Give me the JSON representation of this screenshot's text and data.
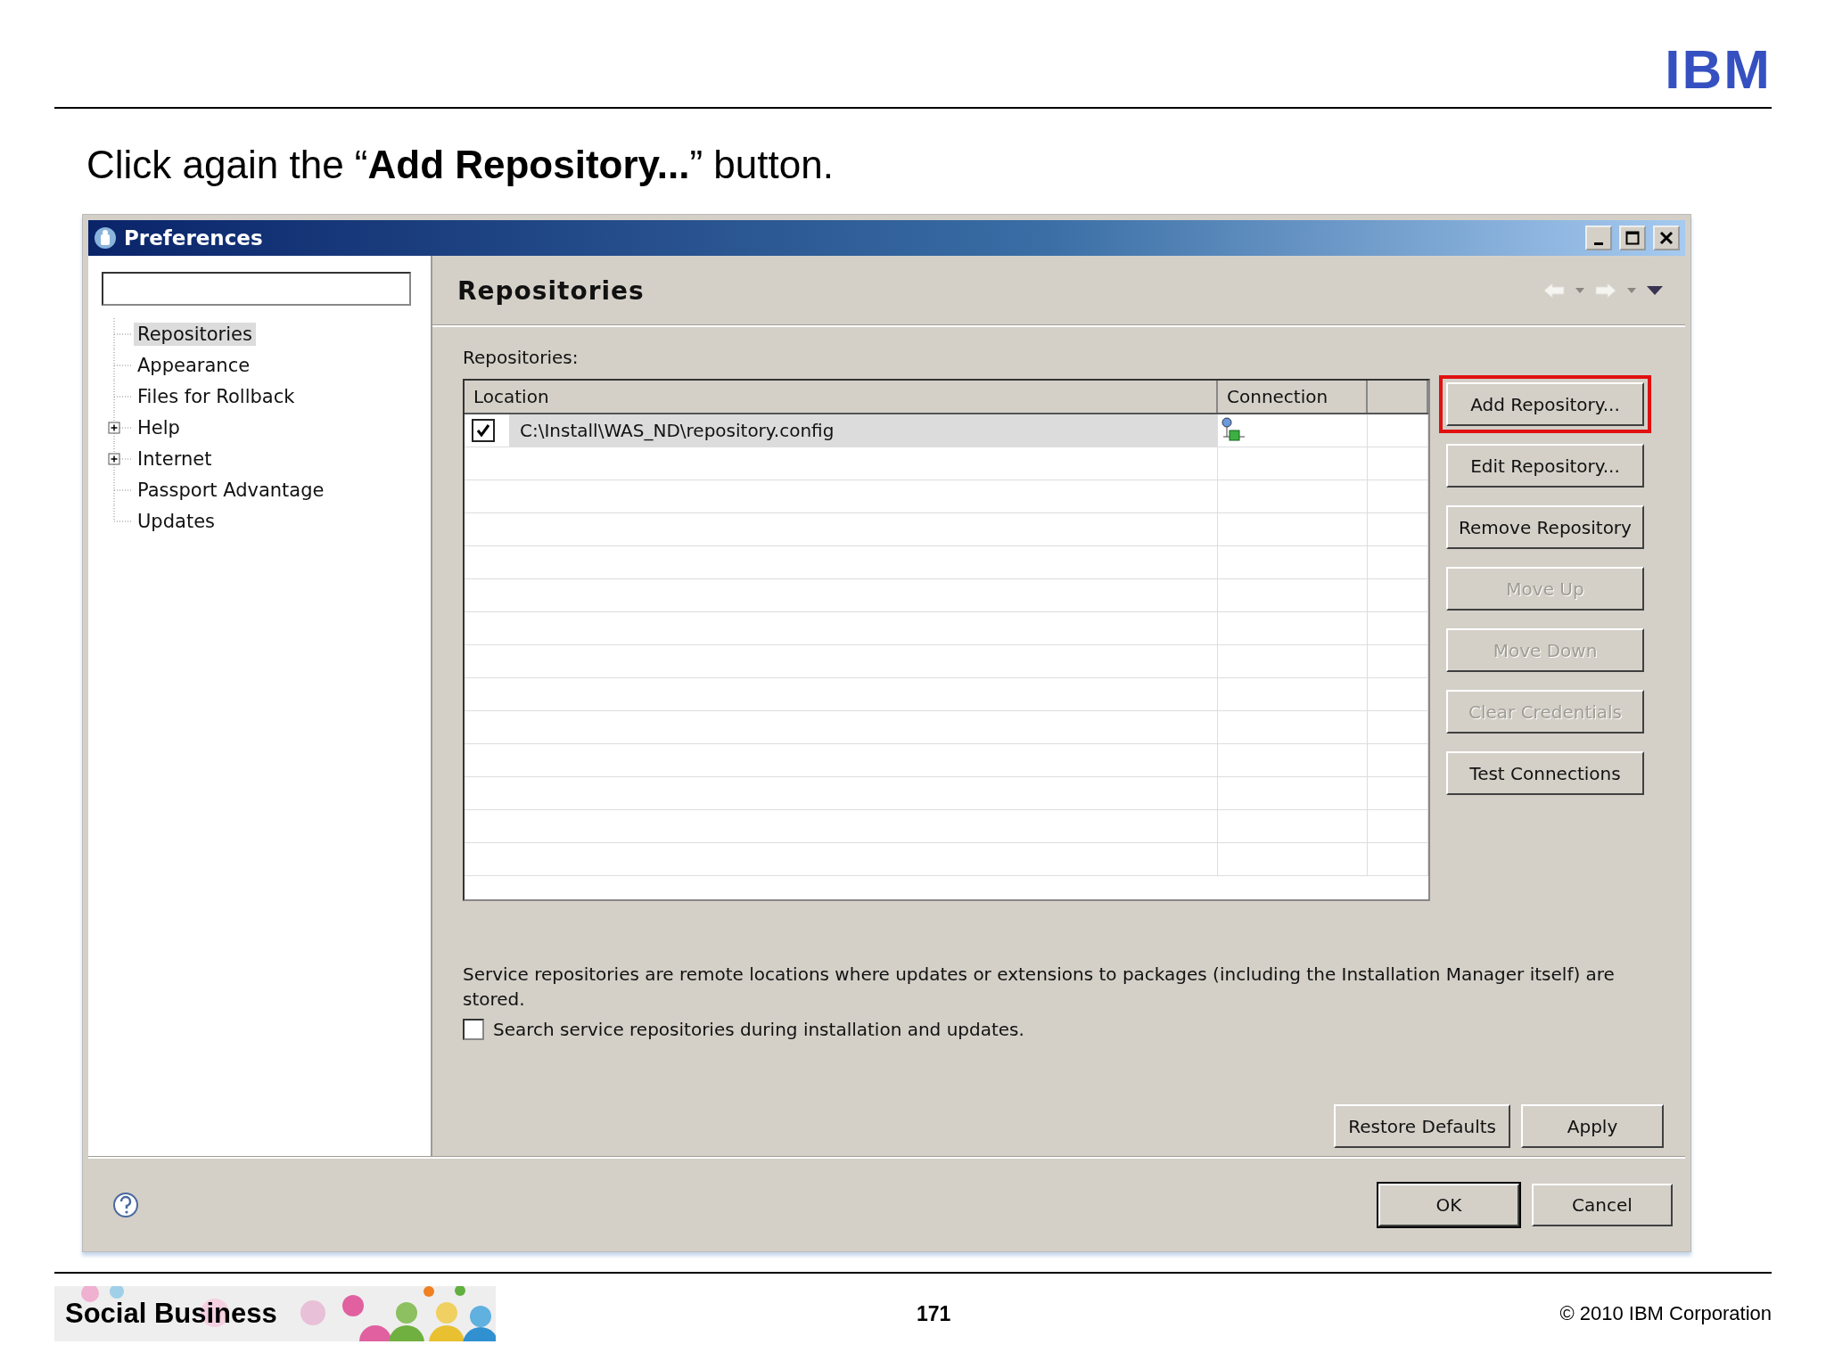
{
  "slide": {
    "logo": "IBM",
    "heading": "Click again the “**Add Repository...**” button.",
    "footer": {
      "banner": "Social Business",
      "page": "171",
      "copyright": "© 2010 IBM Corporation"
    }
  },
  "window": {
    "title": "Preferences"
  },
  "sidebar": {
    "items": [
      {
        "label": "Repositories",
        "selected": true,
        "kind": "leaf"
      },
      {
        "label": "Appearance",
        "selected": false,
        "kind": "leaf"
      },
      {
        "label": "Files for Rollback",
        "selected": false,
        "kind": "leaf"
      },
      {
        "label": "Help",
        "selected": false,
        "kind": "folder"
      },
      {
        "label": "Internet",
        "selected": false,
        "kind": "folder"
      },
      {
        "label": "Passport Advantage",
        "selected": false,
        "kind": "leaf"
      },
      {
        "label": "Updates",
        "selected": false,
        "kind": "leaf"
      }
    ]
  },
  "page": {
    "title": "Repositories",
    "table_label": "Repositories:",
    "table": {
      "columns": [
        "Location",
        "Connection"
      ],
      "rows": [
        {
          "checked": true,
          "selected": true,
          "location": "C:\\Install\\WAS_ND\\repository.config"
        }
      ]
    },
    "side_buttons": [
      {
        "label": "Add Repository...",
        "disabled": false,
        "highlighted": true
      },
      {
        "label": "Edit Repository...",
        "disabled": false,
        "highlighted": false
      },
      {
        "label": "Remove Repository",
        "disabled": false,
        "highlighted": false
      },
      {
        "label": "Move Up",
        "disabled": true,
        "highlighted": false
      },
      {
        "label": "Move Down",
        "disabled": true,
        "highlighted": false
      },
      {
        "label": "Clear Credentials",
        "disabled": true,
        "highlighted": false
      },
      {
        "label": "Test Connections",
        "disabled": false,
        "highlighted": false
      }
    ],
    "description": "Service repositories are remote locations where updates or extensions to packages (including the Installation Manager itself) are stored.",
    "search_option": {
      "label": "Search service repositories during installation and updates.",
      "checked": false
    },
    "buttons": [
      "Restore Defaults",
      "Apply"
    ]
  },
  "dialog_buttons": [
    {
      "label": "OK",
      "default": true
    },
    {
      "label": "Cancel",
      "default": false
    }
  ]
}
